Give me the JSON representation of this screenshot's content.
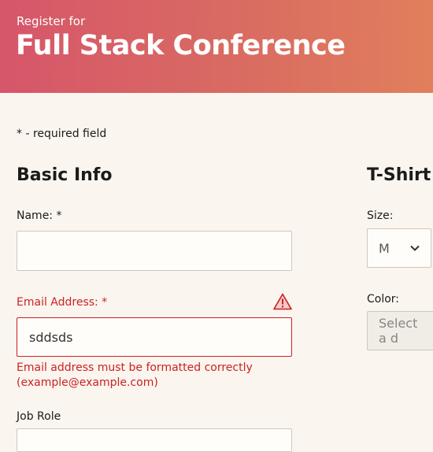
{
  "header": {
    "subtitle": "Register for",
    "title": "Full Stack Conference"
  },
  "required_note": "* - required field",
  "basic_info": {
    "title": "Basic Info",
    "name_label": "Name: *",
    "name_value": "",
    "email_label": "Email Address: *",
    "email_value": "sddsds",
    "email_error": "Email address must be formatted correctly (example@example.com)",
    "job_role_label": "Job Role"
  },
  "tshirt": {
    "title": "T-Shirt I",
    "size_label": "Size:",
    "size_value": "M",
    "color_label": "Color:",
    "color_placeholder": "Select a d"
  },
  "colors": {
    "header_start": "#d6566a",
    "header_end": "#e17f5c",
    "error": "#cc2222",
    "background": "#faf5ef"
  },
  "icons": {
    "warning": "warning-triangle-icon",
    "dropdown": "chevron-down-icon"
  }
}
